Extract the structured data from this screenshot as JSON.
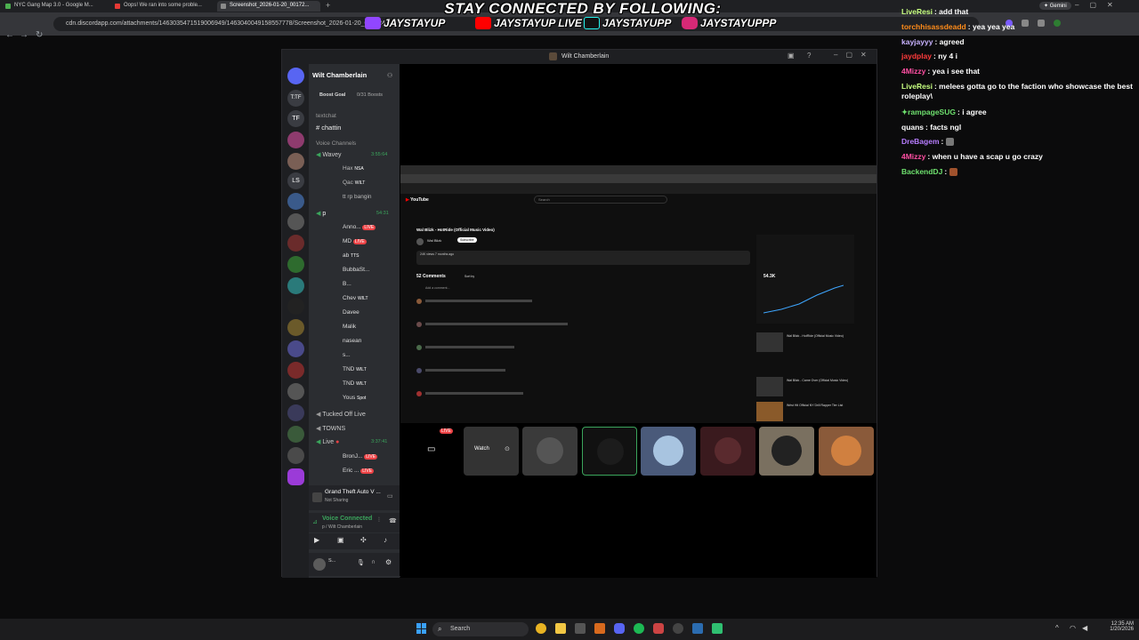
{
  "browser": {
    "tabs": [
      {
        "title": "NYC Gang Map 3.0 - Google M...",
        "favicon_color": "#4caf50"
      },
      {
        "title": "Oops! We ran into some proble...",
        "favicon_color": "#e53935"
      },
      {
        "title": "Screenshot_2026-01-20_00172...",
        "favicon_color": "#8a8a8a"
      }
    ],
    "url": "cdn.discordapp.com/attachments/1463035471519006949/1463040049158557778/Screenshot_2026-01-20_001724...",
    "gemini_label": "Gemini"
  },
  "overlay": {
    "title": "STAY CONNECTED BY FOLLOWING:",
    "socials": [
      {
        "platform": "twitch-icon",
        "handle": "JAYSTAYUP",
        "color": "#9146ff"
      },
      {
        "platform": "youtube-icon",
        "handle": "JAYSTAYUP LIVE",
        "color": "#ff0000"
      },
      {
        "platform": "tiktok-icon",
        "handle": "JAYSTAYUPP",
        "color": "#25f4ee"
      },
      {
        "platform": "instagram-icon",
        "handle": "JAYSTAYUPPP",
        "color": "#d62976"
      }
    ]
  },
  "chat": {
    "messages": [
      {
        "user": "LiveResi",
        "color": "#c7ff80",
        "text": "add that"
      },
      {
        "user": "torchhisassdeadd",
        "color": "#ff8c1a",
        "text": "yea yea yea"
      },
      {
        "user": "kayjayyy",
        "color": "#c9b3ff",
        "text": "agreed"
      },
      {
        "user": "jaydplay",
        "color": "#ff3b3b",
        "text": "ny 4 i"
      },
      {
        "user": "4Mizzy",
        "color": "#ff4fa3",
        "text": "yea i see that"
      },
      {
        "user": "LiveResi",
        "color": "#c7ff80",
        "text": "melees gotta go to the faction who showcase the best roleplay\\"
      },
      {
        "user": "rampageSUG",
        "color": "#6ee06e",
        "text": "i agree"
      },
      {
        "user": "quans",
        "color": "#ffffff",
        "text": "facts ngl"
      },
      {
        "user": "DreBagem",
        "color": "#b77dff",
        "text": ""
      },
      {
        "user": "4Mizzy",
        "color": "#ff4fa3",
        "text": "when u have a scap u go crazy"
      },
      {
        "user": "BackendDJ",
        "color": "#6ee06e",
        "text": ""
      }
    ]
  },
  "discord": {
    "window_title": "Wilt Chamberlain",
    "server_name": "Wilt Chamberlain",
    "boost_goal": "Boost Goal",
    "boosts": "0/31 Boosts",
    "channels": [
      {
        "kind": "category",
        "label": "textchat"
      },
      {
        "kind": "text",
        "label": "chattin"
      },
      {
        "kind": "category",
        "label": "Voice Channels"
      },
      {
        "kind": "voice",
        "label": "Wavey",
        "time": "3:55:64"
      },
      {
        "kind": "user",
        "label": "Hax",
        "tag": "NSA"
      },
      {
        "kind": "user",
        "label": "Qac",
        "tag": "WILT"
      },
      {
        "kind": "user",
        "label": "tt rp bangin",
        "tag": ""
      },
      {
        "kind": "voice",
        "label": "p",
        "time": "54:31"
      },
      {
        "kind": "user",
        "label": "Anno...",
        "tag": "LIVE"
      },
      {
        "kind": "user",
        "label": "MD",
        "tag": "LIVE"
      },
      {
        "kind": "user",
        "label": "ab",
        "tag": "TTS"
      },
      {
        "kind": "user",
        "label": "BubbaSt...",
        "tag": ""
      },
      {
        "kind": "user",
        "label": "B...",
        "tag": ""
      },
      {
        "kind": "user",
        "label": "Chev",
        "tag": "WILT"
      },
      {
        "kind": "user",
        "label": "Davee",
        "tag": ""
      },
      {
        "kind": "user",
        "label": "Malik",
        "tag": ""
      },
      {
        "kind": "user",
        "label": "nasean",
        "tag": ""
      },
      {
        "kind": "user",
        "label": "s...",
        "tag": ""
      },
      {
        "kind": "user",
        "label": "TND",
        "tag": "WILT"
      },
      {
        "kind": "user",
        "label": "TND",
        "tag": "WILT"
      },
      {
        "kind": "user",
        "label": "Yous",
        "tag": "Spot"
      },
      {
        "kind": "voice",
        "label": "Tucked Off Live",
        "time": ""
      },
      {
        "kind": "voice",
        "label": "TOWNS",
        "time": ""
      },
      {
        "kind": "voice",
        "label": "Live",
        "time": "3:37:41"
      },
      {
        "kind": "user",
        "label": "BronJ...",
        "tag": "LIVE"
      },
      {
        "kind": "user",
        "label": "Eric ...",
        "tag": "LIVE"
      }
    ],
    "activity": {
      "title": "Grand Theft Auto V ...",
      "sub": "Not Sharing"
    },
    "voice_status": {
      "title": "Voice Connected",
      "sub": "p / Wilt Chamberlain"
    },
    "user_panel": {
      "name": "S..."
    },
    "stage": {
      "live_badge": "LIVE",
      "watch_label": "Watch",
      "shared_video": {
        "site": "YouTube",
        "search_placeholder": "Search",
        "video_title": "Wal Blizk - HotRide (Official Music Video)",
        "channel": "Wal Blizk",
        "subscribe": "Subscribe",
        "views_line": "24K views  7 months ago",
        "comments_count": "52 Comments",
        "sort_by": "Sort by",
        "add_comment": "Add a comment...",
        "stat_value": "54.3K",
        "next_video": "Wal Blizk - HotRide (Official Music Video)",
        "next_video2": "Wal Blizk - Came Over (Official Music Video)",
        "next_video3": "Wrist Hit Official NY Drill Rapper Tier List"
      }
    }
  },
  "taskbar": {
    "search_label": "Search",
    "time": "12:35 AM",
    "date": "1/20/2026"
  }
}
